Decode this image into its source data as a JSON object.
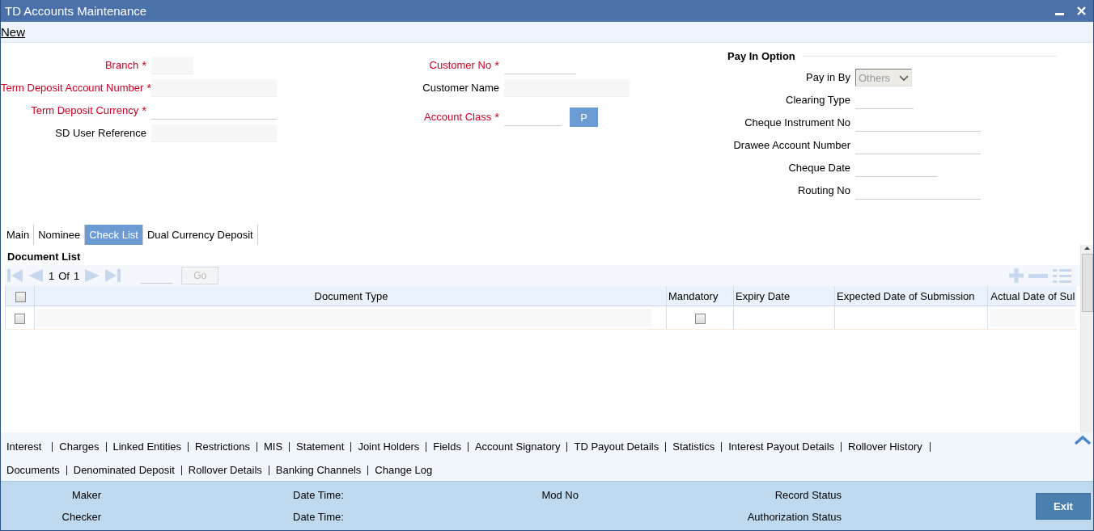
{
  "window": {
    "title": "TD Accounts Maintenance"
  },
  "toolbar": [
    {
      "label": "New"
    }
  ],
  "form": {
    "left": [
      {
        "label": "Branch",
        "required": true,
        "required_mark": "*",
        "kind": "input",
        "disabled": true
      },
      {
        "label": "Term Deposit Account Number",
        "required": true,
        "required_mark": "*",
        "kind": "input",
        "disabled": true
      },
      {
        "label": "Term Deposit Currency",
        "required": true,
        "required_mark": "*",
        "kind": "input",
        "disabled": false
      },
      {
        "label": "SD User Reference",
        "required": false,
        "kind": "input",
        "disabled": true
      }
    ],
    "middle": [
      {
        "label": "Customer No",
        "required": true,
        "required_mark": "*",
        "kind": "input",
        "disabled": false
      },
      {
        "label": "Customer Name",
        "required": false,
        "kind": "input",
        "disabled": true
      },
      {
        "label": "Account Class",
        "required": true,
        "required_mark": "*",
        "kind": "input",
        "disabled": false,
        "button": "P"
      }
    ],
    "pay_in": {
      "title": "Pay In Option",
      "fields": [
        {
          "label": "Pay in By",
          "kind": "select",
          "value": "Others",
          "disabled": true
        },
        {
          "label": "Clearing Type",
          "kind": "input",
          "disabled": false
        },
        {
          "label": "Cheque Instrument No",
          "kind": "input",
          "disabled": false
        },
        {
          "label": "Drawee Account Number",
          "kind": "input",
          "disabled": false
        },
        {
          "label": "Cheque Date",
          "kind": "input",
          "disabled": false
        },
        {
          "label": "Routing No",
          "kind": "input",
          "disabled": false
        }
      ]
    }
  },
  "tabs": [
    {
      "label": "Main",
      "selected": false
    },
    {
      "label": "Nominee",
      "selected": false
    },
    {
      "label": "Check List",
      "selected": true
    },
    {
      "label": "Dual Currency Deposit",
      "selected": false
    }
  ],
  "document_list": {
    "title": "Document List",
    "pager": {
      "page": "1",
      "of": "Of",
      "total": "1",
      "go": "Go"
    },
    "columns": [
      "Document Type",
      "Mandatory",
      "Expiry Date",
      "Expected Date of Submission",
      "Actual Date of Sul"
    ],
    "header_checked": false,
    "rows": [
      {
        "checked": false,
        "mandatory": false
      }
    ]
  },
  "links": [
    [
      "Interest",
      "Charges",
      "Linked Entities",
      "Restrictions",
      "MIS",
      "Statement",
      "Joint Holders",
      "Fields",
      "Account Signatory",
      "TD Payout Details",
      "Statistics",
      "Interest Payout Details",
      "Rollover History"
    ],
    [
      "Documents",
      "Denominated Deposit",
      "Rollover Details",
      "Banking Channels",
      "Change Log"
    ]
  ],
  "footer": {
    "columns": [
      [
        "Maker",
        "Checker"
      ],
      [
        "Date Time:",
        "Date Time:"
      ],
      [
        "Mod No"
      ],
      [
        "Record Status",
        "Authorization Status"
      ]
    ],
    "exit": "Exit"
  }
}
